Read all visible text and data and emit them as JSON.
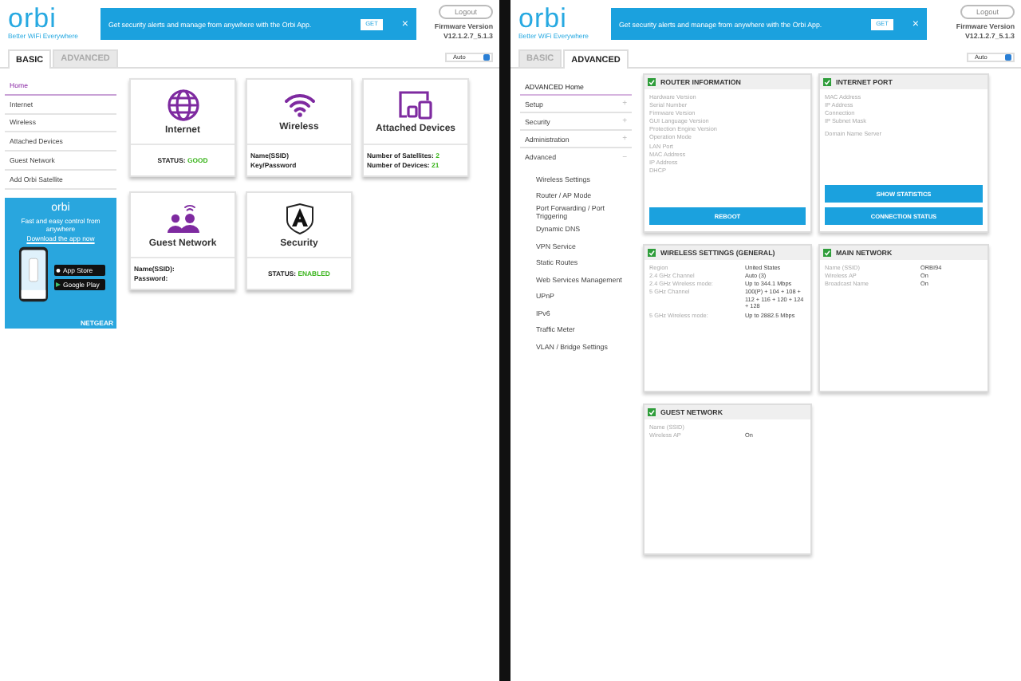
{
  "basic_screen": {
    "header": {
      "logo": "orbi",
      "tagline": "Better WiFi Everywhere",
      "banner": {
        "text": "Get security alerts and manage from anywhere with the Orbi App.",
        "button": "GET",
        "close": "×"
      },
      "logout": "Logout",
      "firmware_label": "Firmware Version",
      "firmware_version": "V12.1.2.7_5.1.3",
      "language": "Auto"
    },
    "tabs": [
      {
        "label": "BASIC",
        "selected": true
      },
      {
        "label": "ADVANCED",
        "selected": false
      }
    ],
    "sidebar": {
      "items": [
        {
          "label": "Home",
          "selected": true
        },
        {
          "label": "Internet",
          "selected": false
        },
        {
          "label": "Wireless",
          "selected": false
        },
        {
          "label": "Attached Devices",
          "selected": false
        },
        {
          "label": "Guest Network",
          "selected": false
        },
        {
          "label": "Add Orbi Satellite",
          "selected": false
        }
      ]
    },
    "ad": {
      "logo": "orbi",
      "text": "Fast and easy control from anywhere",
      "link": "Download the app now",
      "badges": [
        "App Store",
        "Google Play"
      ],
      "brand": "NETGEAR"
    },
    "cards": [
      {
        "title": "Internet",
        "kind": "internet",
        "lines": [
          {
            "label": "STATUS:",
            "value": "GOOD"
          }
        ]
      },
      {
        "title": "Wireless",
        "kind": "wireless",
        "lines": [
          {
            "label": "Name(SSID)"
          },
          {
            "label": "Key/Password"
          }
        ]
      },
      {
        "title": "Attached Devices",
        "kind": "devices",
        "lines": [
          {
            "label": "Number of Satellites:",
            "value": "2"
          },
          {
            "label": "Number of Devices:",
            "value": "21"
          }
        ]
      },
      {
        "title": "Guest Network",
        "kind": "guest",
        "lines": [
          {
            "label": "Name(SSID):"
          },
          {
            "label": "Password:"
          }
        ]
      },
      {
        "title": "Security",
        "kind": "security",
        "lines": [
          {
            "label": "STATUS:",
            "value": "ENABLED"
          }
        ]
      }
    ]
  },
  "advanced_screen": {
    "header": {
      "logo": "orbi",
      "tagline": "Better WiFi Everywhere",
      "banner": {
        "text": "Get security alerts and manage from anywhere with the Orbi App.",
        "button": "GET",
        "close": "×"
      },
      "logout": "Logout",
      "firmware_label": "Firmware Version",
      "firmware_version": "V12.1.2.7_5.1.3",
      "language": "Auto"
    },
    "tabs": [
      {
        "label": "BASIC",
        "selected": false
      },
      {
        "label": "ADVANCED",
        "selected": true
      }
    ],
    "sidebar": {
      "items": [
        {
          "label": "ADVANCED Home",
          "selected": true
        },
        {
          "label": "Setup",
          "toggle": "+",
          "expanded": false,
          "selected": false
        },
        {
          "label": "Security",
          "toggle": "+",
          "expanded": false,
          "selected": false
        },
        {
          "label": "Administration",
          "toggle": "+",
          "expanded": false,
          "selected": false
        },
        {
          "label": "Advanced",
          "toggle": "−",
          "expanded": true,
          "selected": false,
          "children": [
            {
              "label": "Wireless Settings",
              "selected": false
            },
            {
              "label": "Router / AP Mode",
              "selected": false
            },
            {
              "label": "Port Forwarding / Port Triggering",
              "selected": false
            },
            {
              "label": "Dynamic DNS",
              "selected": false
            },
            {
              "label": "VPN Service",
              "selected": false
            },
            {
              "label": "Static Routes",
              "selected": false
            },
            {
              "label": "Web Services Management",
              "selected": false
            },
            {
              "label": "UPnP",
              "selected": false
            },
            {
              "label": "IPv6",
              "selected": false
            },
            {
              "label": "Traffic Meter",
              "selected": false
            },
            {
              "label": "VLAN / Bridge Settings",
              "selected": false
            }
          ]
        }
      ]
    },
    "panels": [
      {
        "title": "ROUTER INFORMATION",
        "checked": true,
        "rows": [
          {
            "label": "Hardware Version"
          },
          {
            "label": "Serial Number"
          },
          {
            "label": "Firmware Version"
          },
          {
            "label": "GUI Language Version"
          },
          {
            "label": "Protection Engine Version"
          },
          {
            "label": "Operation Mode"
          },
          {
            "label": "LAN Port"
          },
          {
            "label": "MAC Address"
          },
          {
            "label": "IP Address"
          },
          {
            "label": "DHCP"
          }
        ],
        "buttons": [
          "REBOOT"
        ]
      },
      {
        "title": "INTERNET PORT",
        "checked": true,
        "rows": [
          {
            "label": "MAC Address"
          },
          {
            "label": "IP Address"
          },
          {
            "label": "Connection"
          },
          {
            "label": "IP Subnet Mask"
          },
          {
            "label": "Domain Name Server"
          }
        ],
        "buttons": [
          "SHOW STATISTICS",
          "CONNECTION STATUS"
        ]
      },
      {
        "title": "WIRELESS SETTINGS (GENERAL)",
        "checked": true,
        "rows": [
          {
            "label": "Region",
            "value": "United States"
          },
          {
            "label": "2.4 GHz Channel",
            "value": "Auto (3)"
          },
          {
            "label": "2.4 GHz Wireless mode:",
            "value": "Up to 344.1 Mbps"
          },
          {
            "label": "5 GHz Channel",
            "value": "100(P) + 104 + 108 + 112 + 116 + 120 + 124 + 128"
          },
          {
            "label": "5 GHz Wireless mode:",
            "value": "Up to 2882.5 Mbps"
          }
        ]
      },
      {
        "title": "MAIN NETWORK",
        "checked": true,
        "rows": [
          {
            "label": "Name (SSID)",
            "value": "ORBI94"
          },
          {
            "label": "Wireless AP",
            "value": "On"
          },
          {
            "label": "Broadcast Name",
            "value": "On"
          }
        ]
      },
      {
        "title": "GUEST NETWORK",
        "checked": true,
        "rows": [
          {
            "label": "Name (SSID)"
          },
          {
            "label": "Wireless AP",
            "value": "On"
          }
        ]
      }
    ]
  }
}
